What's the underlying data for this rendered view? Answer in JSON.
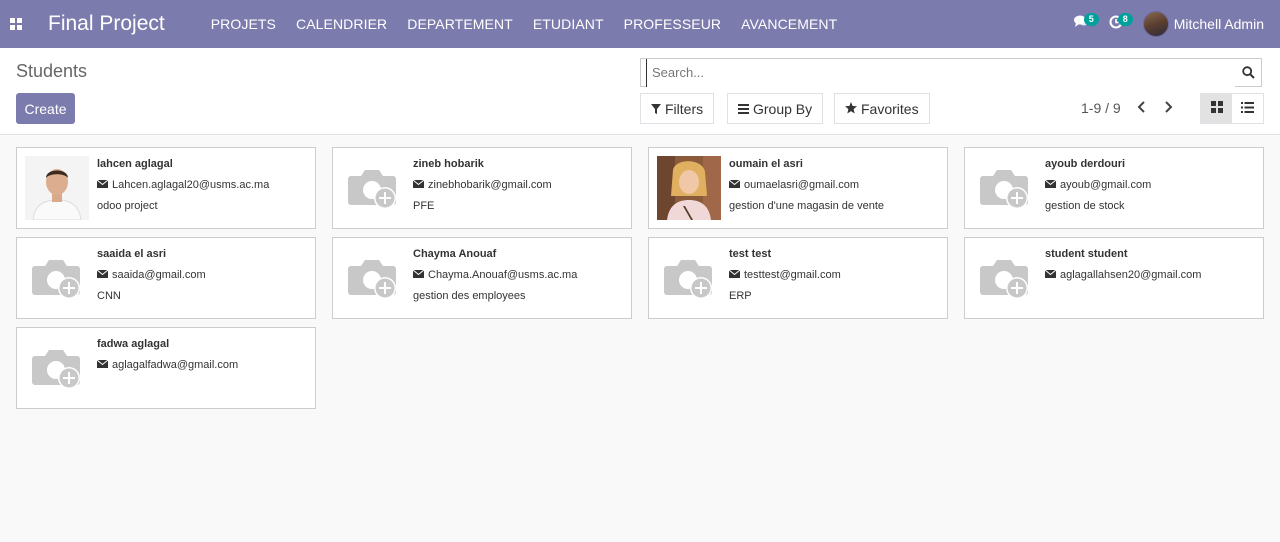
{
  "navbar": {
    "app_title": "Final Project",
    "menu": [
      "PROJETS",
      "CALENDRIER",
      "DEPARTEMENT",
      "ETUDIANT",
      "PROFESSEUR",
      "AVANCEMENT"
    ],
    "messages_count": "5",
    "activities_count": "8",
    "user_name": "Mitchell Admin",
    "color": "#7c7bad"
  },
  "control": {
    "breadcrumb": "Students",
    "create_label": "Create",
    "search_placeholder": "Search...",
    "filters_label": "Filters",
    "groupby_label": "Group By",
    "favorites_label": "Favorites",
    "pager_value": "1-9 / 9"
  },
  "students": [
    {
      "name": "lahcen aglagal",
      "email": "Lahcen.aglagal20@usms.ac.ma",
      "note": "odoo project",
      "photo": "man"
    },
    {
      "name": "zineb hobarik",
      "email": "zinebhobarik@gmail.com",
      "note": "PFE",
      "photo": "placeholder"
    },
    {
      "name": "oumain el asri",
      "email": "oumaelasri@gmail.com",
      "note": "gestion d'une magasin de vente",
      "photo": "woman"
    },
    {
      "name": "ayoub derdouri",
      "email": "ayoub@gmail.com",
      "note": "gestion de stock",
      "photo": "placeholder"
    },
    {
      "name": "saaida el asri",
      "email": "saaida@gmail.com",
      "note": "CNN",
      "photo": "placeholder"
    },
    {
      "name": "Chayma Anouaf",
      "email": "Chayma.Anouaf@usms.ac.ma",
      "note": "gestion des employees",
      "photo": "placeholder"
    },
    {
      "name": "test test",
      "email": "testtest@gmail.com",
      "note": "ERP",
      "photo": "placeholder"
    },
    {
      "name": "student student",
      "email": "aglagallahsen20@gmail.com",
      "note": "",
      "photo": "placeholder"
    },
    {
      "name": "fadwa aglagal",
      "email": "aglagalfadwa@gmail.com",
      "note": "",
      "photo": "placeholder"
    }
  ]
}
